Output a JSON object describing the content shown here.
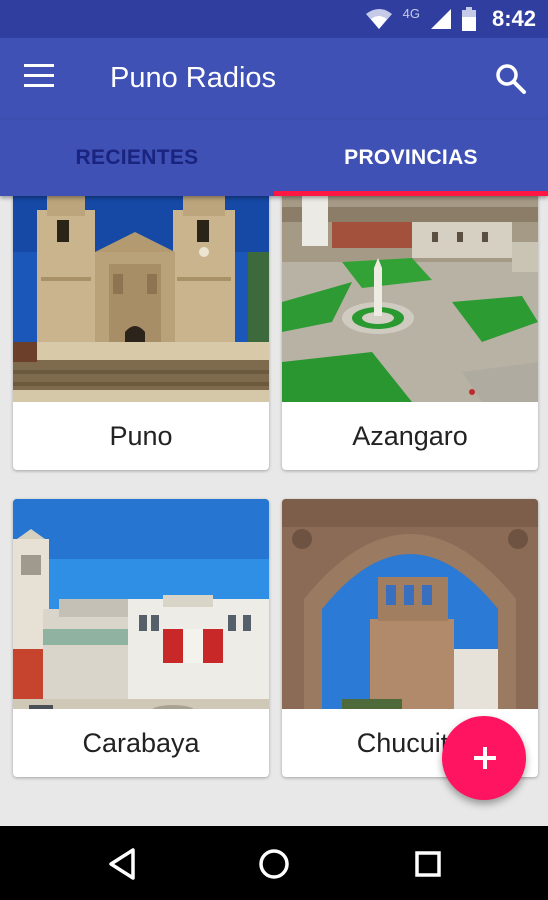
{
  "status_bar": {
    "network": "4G",
    "time": "8:42"
  },
  "app_bar": {
    "title": "Puno Radios"
  },
  "tabs": [
    {
      "label": "RECIENTES",
      "active": false
    },
    {
      "label": "PROVINCIAS",
      "active": true
    }
  ],
  "provinces": [
    {
      "name": "Puno"
    },
    {
      "name": "Azangaro"
    },
    {
      "name": "Carabaya"
    },
    {
      "name": "Chucuito"
    }
  ],
  "icons": {
    "menu": "menu-icon",
    "search": "search-icon",
    "add": "plus-icon",
    "back": "back-triangle-icon",
    "home": "home-circle-icon",
    "recents": "recents-square-icon"
  },
  "colors": {
    "primary_dark": "#303f9f",
    "primary": "#3f51b5",
    "accent": "#ff1461",
    "tab_indicator": "#ff1744"
  }
}
